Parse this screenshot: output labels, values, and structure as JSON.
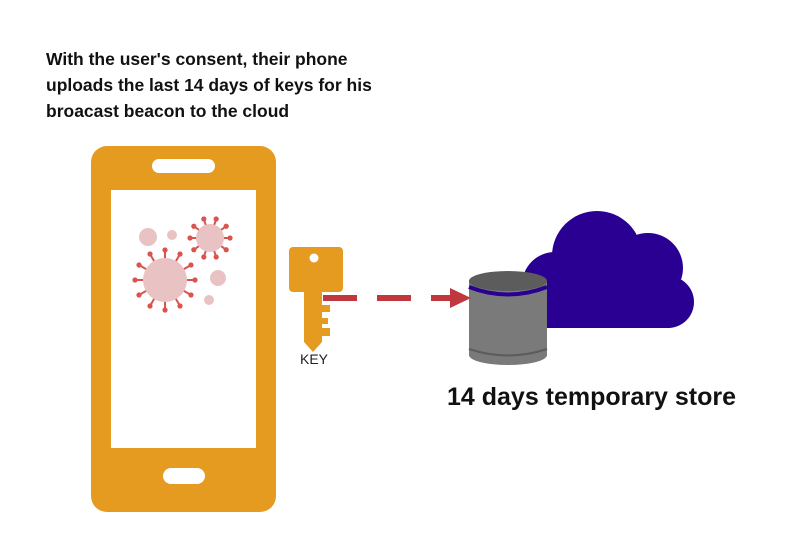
{
  "caption": "With the user's consent, their phone uploads the last 14 days of keys for his broacast beacon to the cloud",
  "key_label": "KEY",
  "store_label": "14 days temporary store",
  "icons": {
    "phone": "smartphone-icon",
    "virus": "virus-icon",
    "key": "key-icon",
    "arrow": "dashed-arrow",
    "database": "database-icon",
    "cloud": "cloud-icon"
  },
  "colors": {
    "phone": "#E49B1F",
    "key": "#E49B1F",
    "screen": "#FFFFFF",
    "virus_fill": "#E9C3C3",
    "virus_spikes": "#D9534F",
    "arrow": "#C0383D",
    "cloud": "#2A0093",
    "database_body": "#7A7A7A",
    "database_top": "#5C5C5C",
    "database_band": "#2A0093"
  }
}
